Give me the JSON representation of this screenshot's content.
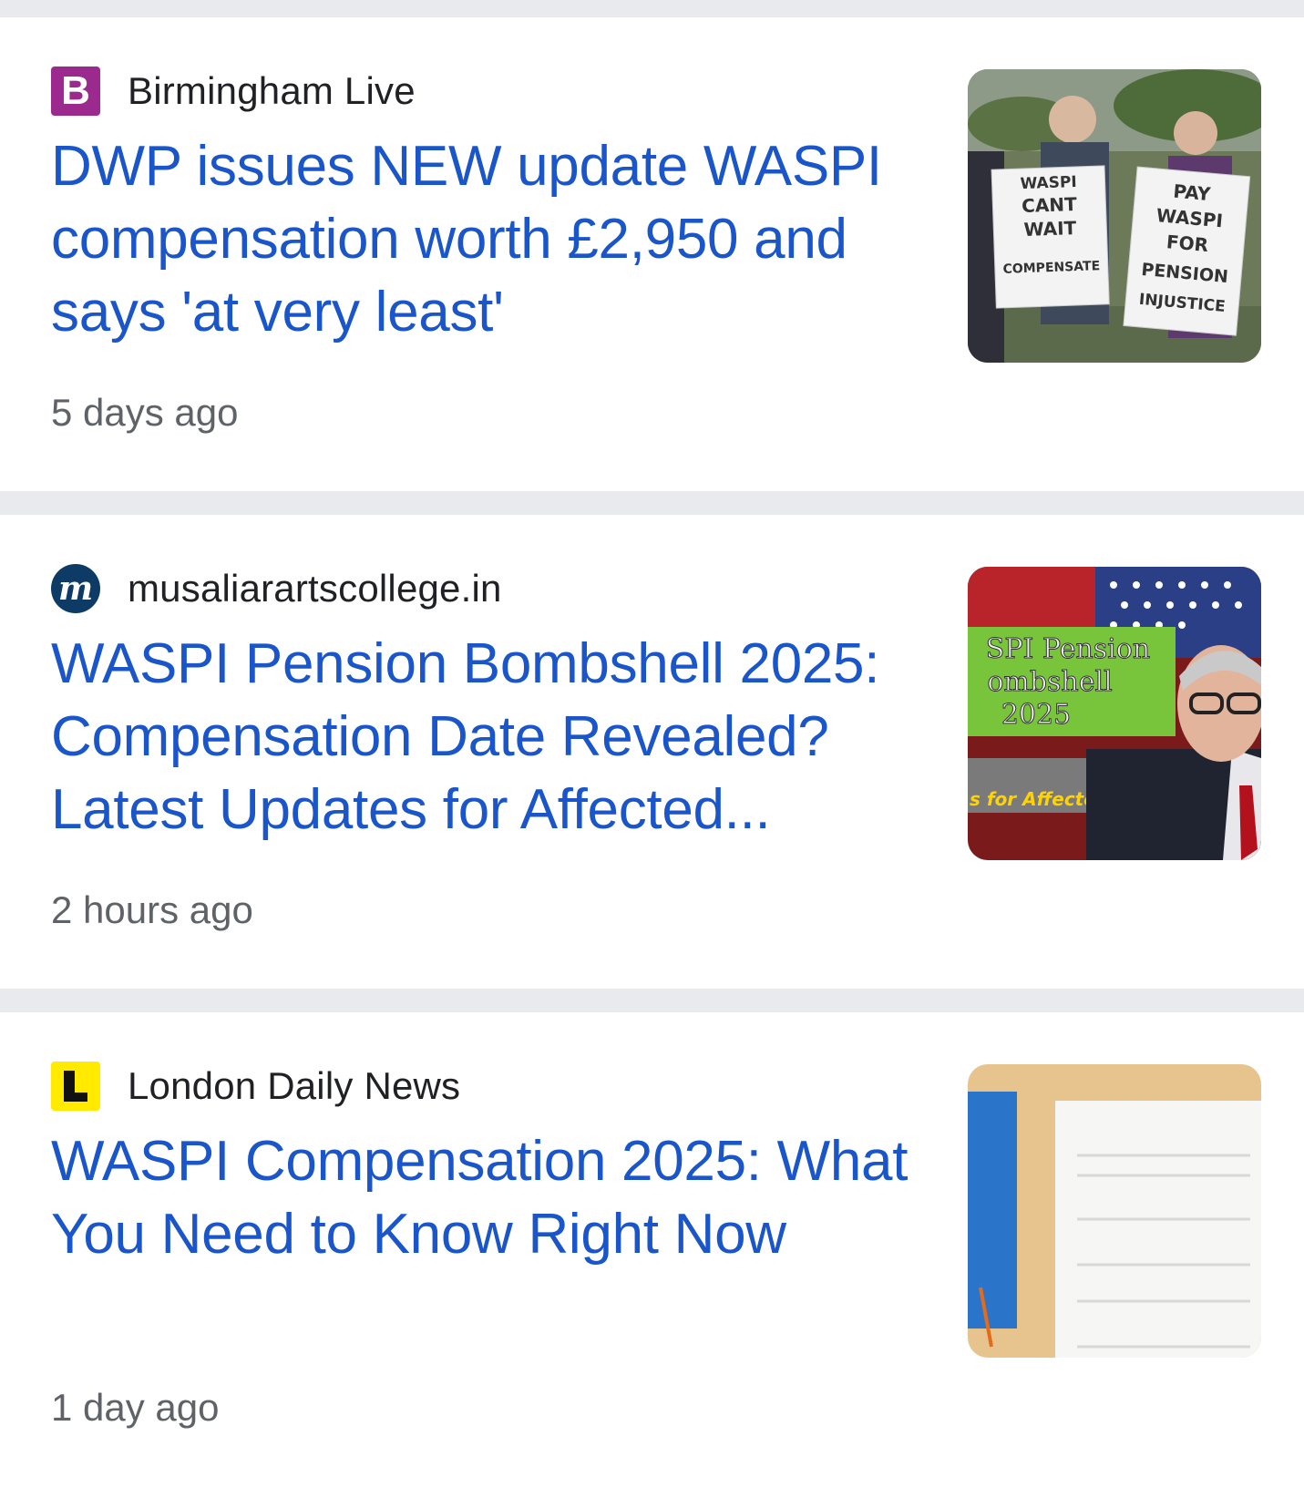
{
  "articles": [
    {
      "source": "Birmingham Live",
      "logo_letter": "B",
      "logo_color": "#9c2a8e",
      "headline": "DWP issues NEW update WASPI compensation worth £2,950 and says 'at very least'",
      "time": "5 days ago",
      "thumbnail": {
        "sign1": [
          "WASPI",
          "CANT",
          "WAIT",
          "COMPENSATE"
        ],
        "sign2": [
          "PAY",
          "WASPI",
          "FOR",
          "PENSION",
          "INJUSTICE"
        ]
      }
    },
    {
      "source": "musaliarartscollege.in",
      "logo_letter": "m",
      "logo_color": "#0d3b66",
      "headline": "WASPI Pension Bombshell 2025: Compensation Date Revealed? Latest Updates for Affected...",
      "time": "2 hours ago",
      "thumbnail": {
        "lines": [
          "SPI Pension",
          "ombshell",
          "2025"
        ],
        "caption": "s for Affected"
      }
    },
    {
      "source": "London Daily News",
      "logo_letter": "L",
      "logo_color": "#ffea00",
      "headline": "WASPI Compensation 2025: What You Need to Know Right Now",
      "time": "1 day ago"
    }
  ],
  "colors": {
    "headline": "#1a56c9",
    "divider": "#e8eaed"
  }
}
